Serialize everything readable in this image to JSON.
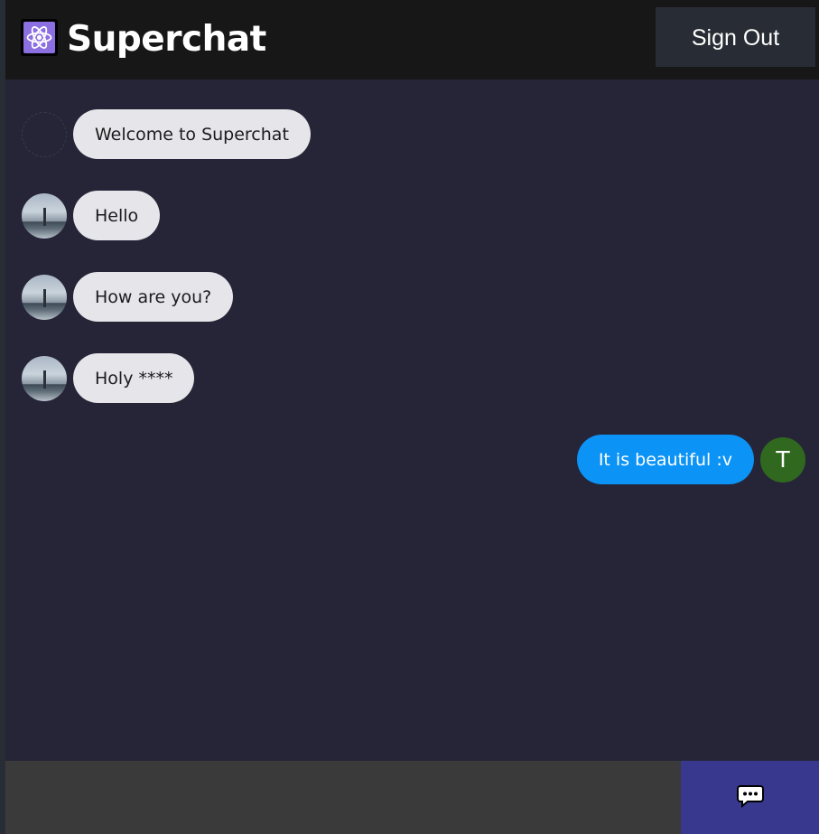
{
  "header": {
    "title": "Superchat",
    "logo_icon": "atom-icon",
    "sign_out_label": "Sign Out"
  },
  "messages": [
    {
      "text": "Welcome to Superchat",
      "direction": "received",
      "avatar": "blank"
    },
    {
      "text": "Hello",
      "direction": "received",
      "avatar": "photo"
    },
    {
      "text": "How are you?",
      "direction": "received",
      "avatar": "photo"
    },
    {
      "text": "Holy ****",
      "direction": "received",
      "avatar": "photo"
    },
    {
      "text": "It is beautiful :v",
      "direction": "sent",
      "avatar": "letter",
      "avatar_letter": "T"
    }
  ],
  "composer": {
    "value": "",
    "send_icon": "chat-bubble-icon"
  },
  "colors": {
    "header_bg": "#181717",
    "chat_bg": "#262537",
    "received_bubble": "#e5e5ea",
    "sent_bubble": "#0b93f6",
    "send_button": "#38388f",
    "input_bg": "#3a3a3a",
    "logo_bg": "#8c6fe0",
    "user_avatar": "#306820"
  }
}
